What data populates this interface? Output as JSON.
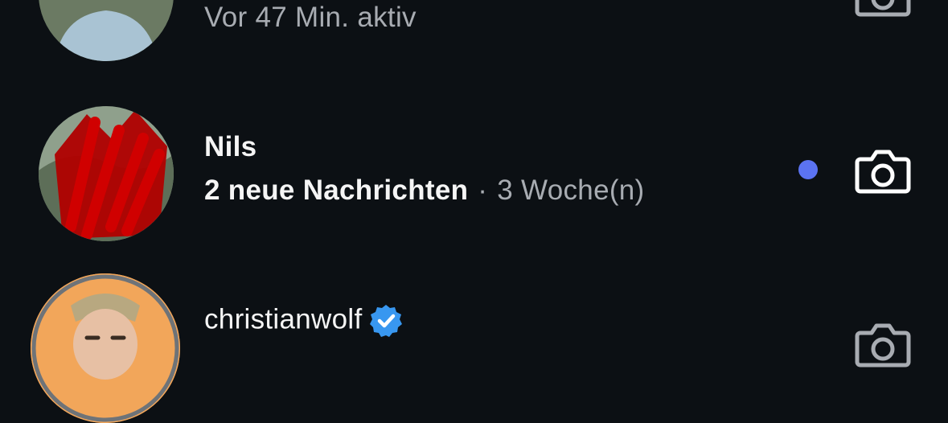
{
  "conversations": [
    {
      "status": "Vor 47 Min. aktiv"
    },
    {
      "name": "Nils",
      "preview": "2 neue Nachrichten",
      "separator": "·",
      "time": "3 Woche(n)",
      "unread": true
    },
    {
      "name": "christianwolf",
      "verified": true
    }
  ],
  "colors": {
    "background": "#0c1014",
    "unread_dot": "#5b73f2",
    "verified_badge": "#3897f0",
    "text_primary": "#f5f5f5",
    "text_secondary": "#a8acb2"
  },
  "icons": {
    "camera": "camera-icon",
    "verified": "verified-badge-icon"
  }
}
